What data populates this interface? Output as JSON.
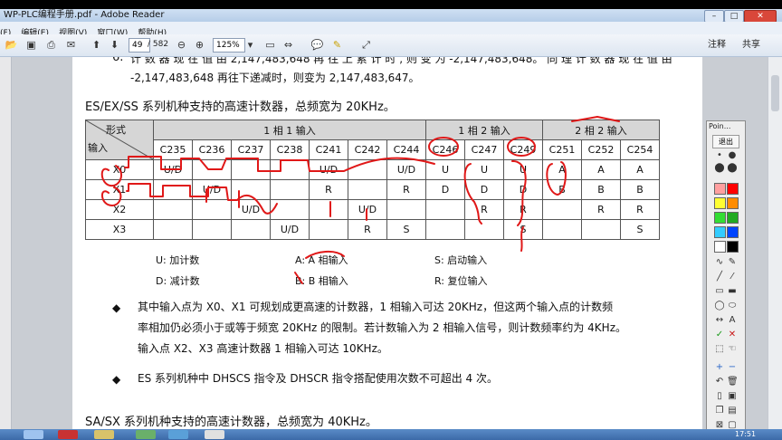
{
  "window": {
    "title": "WP-PLC编程手册.pdf - Adobe Reader",
    "minimize": "–",
    "maximize": "□",
    "close": "✕"
  },
  "menu": [
    "(F)",
    "编辑(E)",
    "视图(V)",
    "窗口(W)",
    "帮助(H)"
  ],
  "toolbar": {
    "page_current": "49",
    "page_total": "/ 582",
    "zoom": "125%",
    "comment": "注释",
    "share": "共享"
  },
  "doc": {
    "prev_line1": "计 数 器 现 在 值 由 2,147,483,648 再 往 上 累 计 时 , 则 变 为 -2,147,483,648。 同 理 计 数 器 现 在 值 由",
    "prev_line1_num": "6.",
    "prev_line2": "-2,147,483,648 再往下递减时，则变为 2,147,483,647。",
    "heading1": "ES/EX/SS 系列机种支持的高速计数器，总频宽为 20KHz。",
    "table": {
      "corner_top": "形式",
      "corner_bottom": "输入",
      "group1": "1 相 1 输入",
      "group2": "1 相 2 输入",
      "group3": "2 相 2 输入",
      "counters": [
        "C235",
        "C236",
        "C237",
        "C238",
        "C241",
        "C242",
        "C244",
        "C246",
        "C247",
        "C249",
        "C251",
        "C252",
        "C254"
      ],
      "rows": [
        {
          "input": "X0",
          "cells": [
            "U/D",
            "",
            "",
            "",
            "U/D",
            "",
            "U/D",
            "U",
            "U",
            "U",
            "A",
            "A",
            "A"
          ]
        },
        {
          "input": "X1",
          "cells": [
            "",
            "U/D",
            "",
            "",
            "R",
            "",
            "R",
            "D",
            "D",
            "D",
            "B",
            "B",
            "B"
          ]
        },
        {
          "input": "X2",
          "cells": [
            "",
            "",
            "U/D",
            "",
            "",
            "U/D",
            "",
            "",
            "R",
            "R",
            "",
            "R",
            "R"
          ]
        },
        {
          "input": "X3",
          "cells": [
            "",
            "",
            "",
            "U/D",
            "",
            "R",
            "S",
            "",
            "",
            "S",
            "",
            "",
            "S"
          ]
        }
      ]
    },
    "legend": {
      "u": "U:   加计数",
      "a": "A:   A 相输入",
      "s": "S:   启动输入",
      "d": "D:   减计数",
      "b": "B:   B 相输入",
      "r": "R:   复位输入"
    },
    "bullet_mark": "◆",
    "note1_l1": "其中输入点为 X0、X1 可规划成更高速的计数器，1 相输入可达 20KHz，但这两个输入点的计数频",
    "note1_l2": "率相加仍必须小于或等于频宽 20KHz 的限制。若计数输入为 2 相输入信号，则计数频率约为 4KHz。",
    "note1_l3": "输入点 X2、X3 高速计数器 1 相输入可达 10KHz。",
    "note2": "ES 系列机种中 DHSCS 指令及 DHSCR 指令搭配使用次数不可超出 4 次。",
    "heading2": "SA/SX 系列机种支持的高速计数器，总频宽为 40KHz。"
  },
  "ink_panel": {
    "title": "Poin...",
    "exit": "退出",
    "colors": [
      "#ff9f9f",
      "#ff0000",
      "#ffff33",
      "#ff8c00",
      "#33dd33",
      "#22aa22",
      "#33ccff",
      "#0044ff",
      "#ffffff",
      "#000000"
    ]
  },
  "taskbar": {
    "clock": "17:51"
  }
}
